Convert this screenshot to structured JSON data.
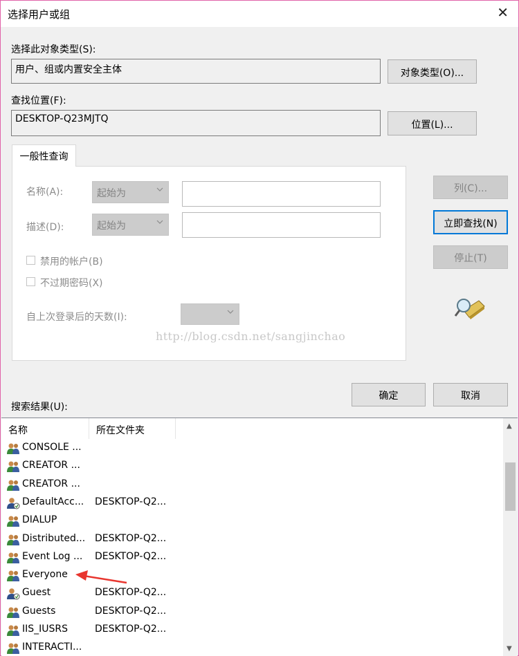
{
  "window": {
    "title": "选择用户或组"
  },
  "object_type": {
    "label": "选择此对象类型(S):",
    "value": "用户、组或内置安全主体",
    "button": "对象类型(O)..."
  },
  "location": {
    "label": "查找位置(F):",
    "value": "DESKTOP-Q23MJTQ",
    "button": "位置(L)..."
  },
  "query": {
    "tab": "一般性查询",
    "name_label": "名称(A):",
    "name_mode": "起始为",
    "desc_label": "描述(D):",
    "desc_mode": "起始为",
    "disabled_accounts": "禁用的帐户(B)",
    "non_expiring": "不过期密码(X)",
    "days_label": "自上次登录后的天数(I):"
  },
  "side_buttons": {
    "columns": "列(C)...",
    "find_now": "立即查找(N)",
    "stop": "停止(T)"
  },
  "dialog_buttons": {
    "ok": "确定",
    "cancel": "取消"
  },
  "results": {
    "label": "搜索结果(U):",
    "headers": [
      "名称",
      "所在文件夹"
    ],
    "rows": [
      {
        "name": "CONSOLE ...",
        "folder": "",
        "icon": "group-icon"
      },
      {
        "name": "CREATOR ...",
        "folder": "",
        "icon": "group-icon"
      },
      {
        "name": "CREATOR ...",
        "folder": "",
        "icon": "group-icon"
      },
      {
        "name": "DefaultAcc...",
        "folder": "DESKTOP-Q2...",
        "icon": "user-icon"
      },
      {
        "name": "DIALUP",
        "folder": "",
        "icon": "group-icon"
      },
      {
        "name": "Distributed...",
        "folder": "DESKTOP-Q2...",
        "icon": "group-icon"
      },
      {
        "name": "Event Log ...",
        "folder": "DESKTOP-Q2...",
        "icon": "group-icon"
      },
      {
        "name": "Everyone",
        "folder": "",
        "icon": "group-icon"
      },
      {
        "name": "Guest",
        "folder": "DESKTOP-Q2...",
        "icon": "user-icon"
      },
      {
        "name": "Guests",
        "folder": "DESKTOP-Q2...",
        "icon": "group-icon"
      },
      {
        "name": "IIS_IUSRS",
        "folder": "DESKTOP-Q2...",
        "icon": "group-icon"
      },
      {
        "name": "INTERACTI...",
        "folder": "",
        "icon": "group-icon"
      }
    ]
  },
  "watermark": "http://blog.csdn.net/sangjinchao",
  "colors": {
    "accent": "#0078d7",
    "frame": "#e062a8",
    "arrow": "#e8352e"
  }
}
